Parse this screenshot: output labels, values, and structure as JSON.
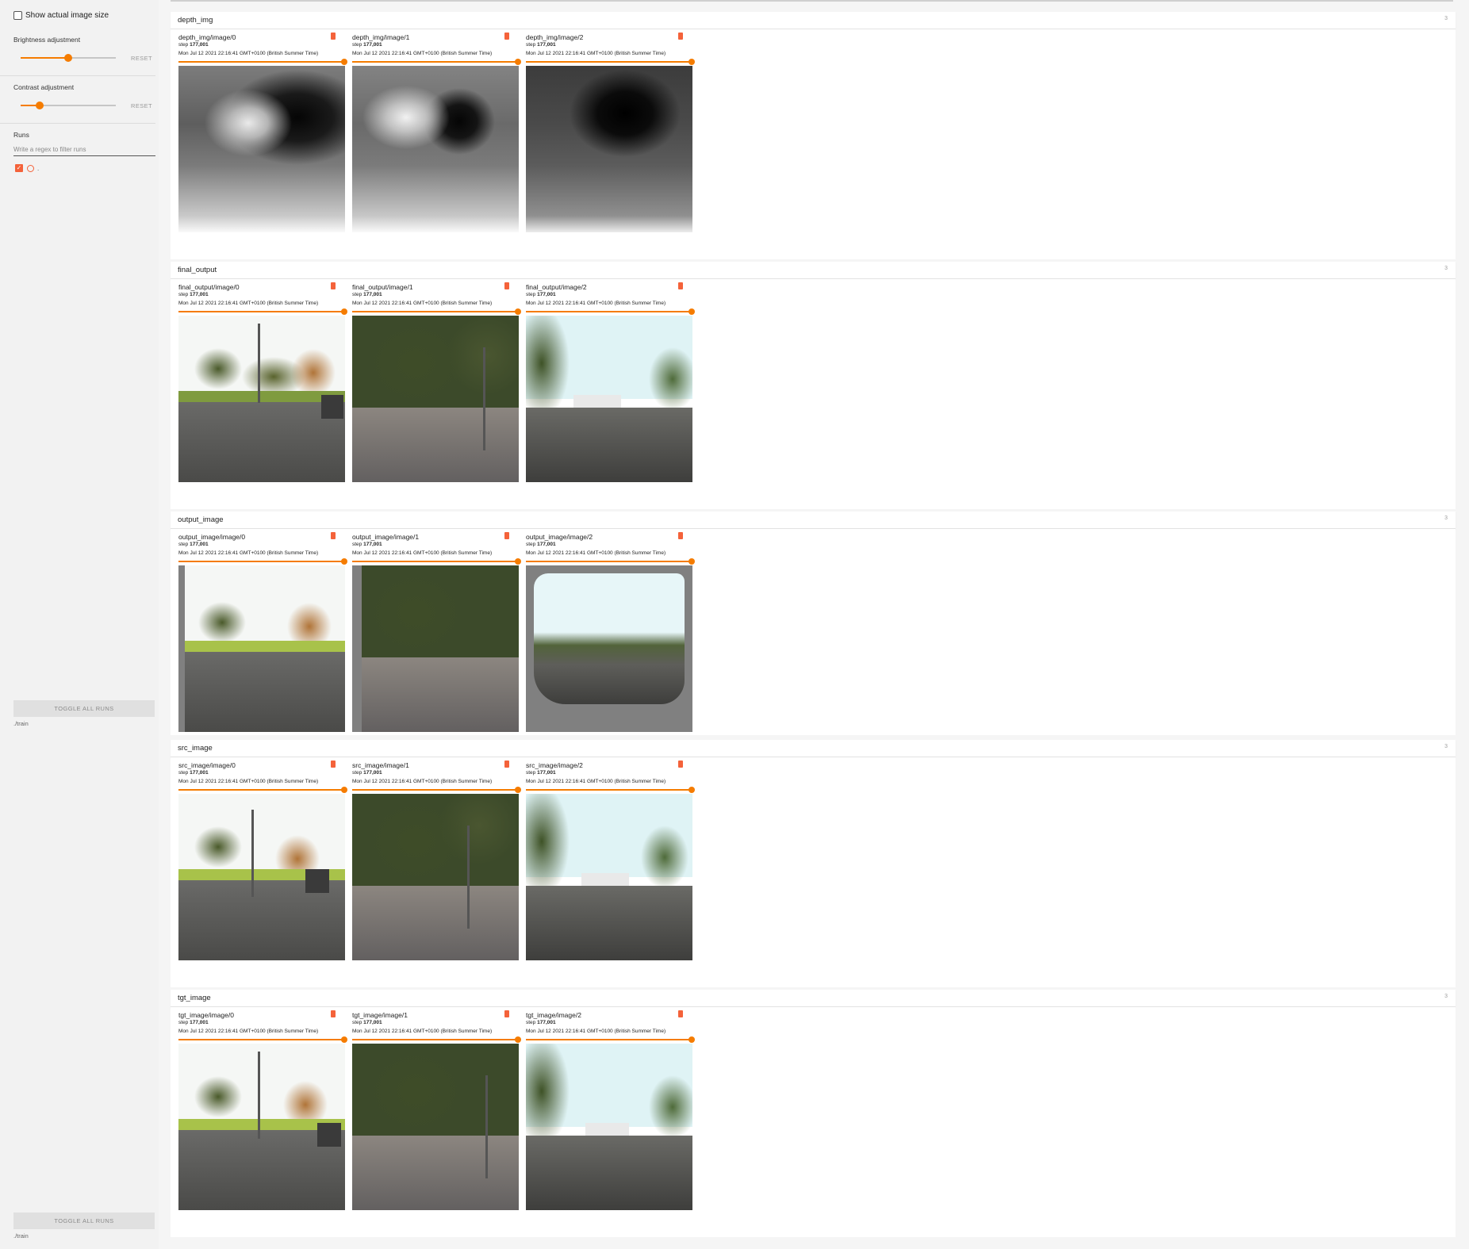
{
  "sidebar": {
    "show_actual_size_label": "Show actual image size",
    "brightness_label": "Brightness adjustment",
    "brightness_value": 0.5,
    "contrast_label": "Contrast adjustment",
    "contrast_value": 0.2,
    "reset_label": "RESET",
    "runs_label": "Runs",
    "filter_placeholder": "Write a regex to filter runs",
    "run_name": ".",
    "toggle_all_label": "TOGGLE ALL RUNS",
    "train_path": "./train"
  },
  "colors": {
    "accent": "#f57c00",
    "run_color": "#f4623a"
  },
  "card_meta": {
    "step_label": "step",
    "step_value": "177,001",
    "date": "Mon Jul 12 2021 22:16:41 GMT+0100 (British Summer Time)"
  },
  "sections": [
    {
      "title": "depth_img",
      "count": "3",
      "cards": [
        "depth_img/image/0",
        "depth_img/image/1",
        "depth_img/image/2"
      ]
    },
    {
      "title": "final_output",
      "count": "3",
      "cards": [
        "final_output/image/0",
        "final_output/image/1",
        "final_output/image/2"
      ]
    },
    {
      "title": "output_image",
      "count": "3",
      "cards": [
        "output_image/image/0",
        "output_image/image/1",
        "output_image/image/2"
      ]
    },
    {
      "title": "src_image",
      "count": "3",
      "cards": [
        "src_image/image/0",
        "src_image/image/1",
        "src_image/image/2"
      ]
    },
    {
      "title": "tgt_image",
      "count": "3",
      "cards": [
        "tgt_image/image/0",
        "tgt_image/image/1",
        "tgt_image/image/2"
      ]
    }
  ]
}
